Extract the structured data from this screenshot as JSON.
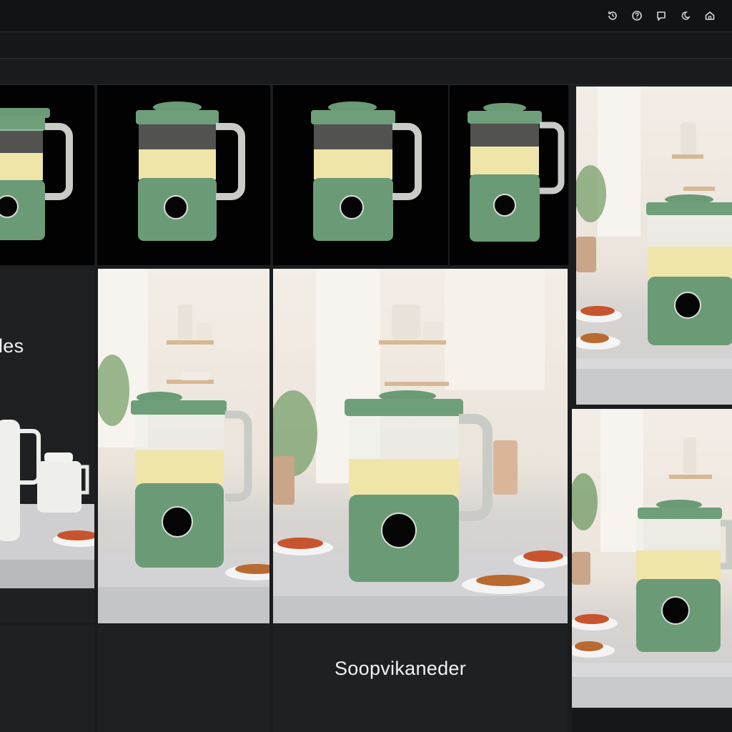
{
  "toolbar": {
    "icons": [
      "history-icon",
      "help-icon",
      "chat-icon",
      "moon-icon",
      "home-icon"
    ]
  },
  "gallery": {
    "left_caption": "les",
    "main_caption": "Soopvikaneder"
  },
  "colors": {
    "blender_green": "#6a9b76",
    "blender_dark": "#557f60",
    "soup": "#efe5a8",
    "handle": "#c9cbc7",
    "background": "#1b1c1e"
  }
}
